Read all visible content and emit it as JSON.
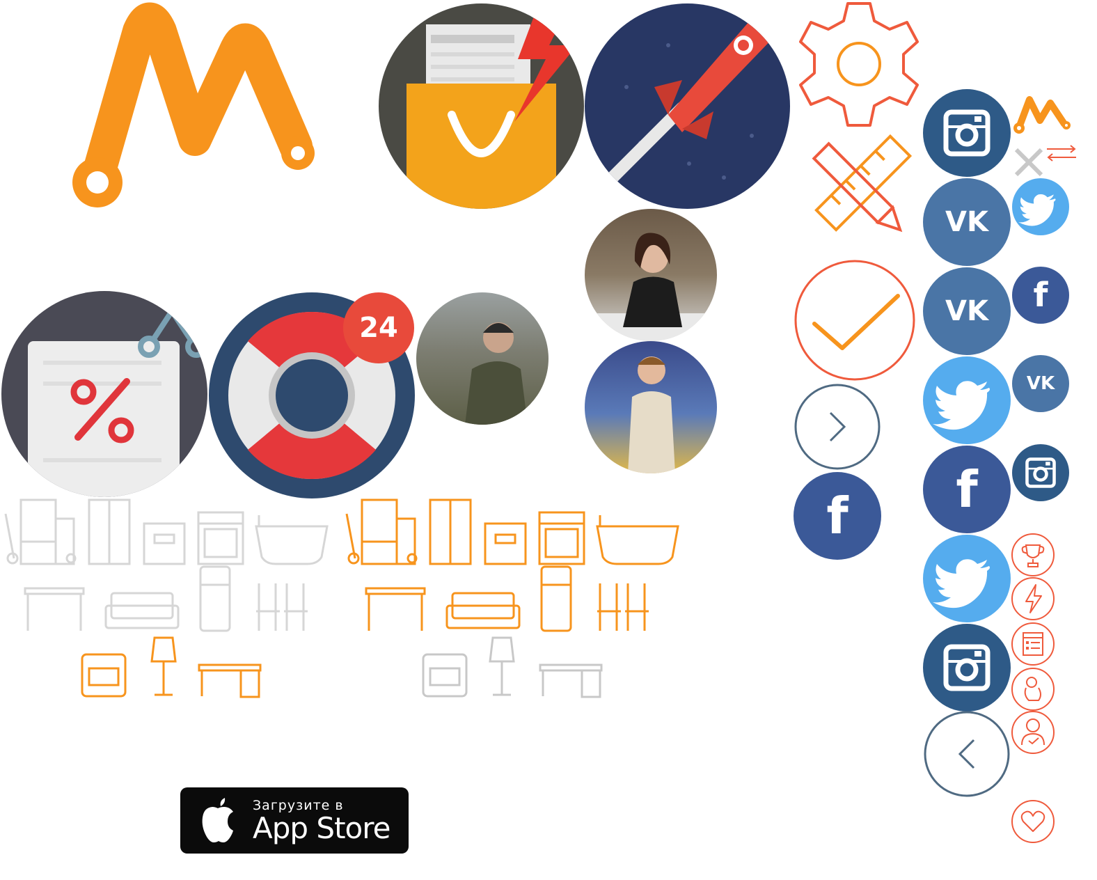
{
  "colors": {
    "brand_orange": "#f7941d",
    "icon_red": "#ef5a3c",
    "instagram": "#2e5a87",
    "vk": "#4a75a6",
    "twitter": "#55acee",
    "facebook": "#3b5998",
    "dark_navy": "#283764",
    "support_navy": "#2e4a6e",
    "gray_line": "#c8c8c8"
  },
  "logo": {
    "icon": "m-logo-icon"
  },
  "icons": {
    "shop": "shopping-bag-icon",
    "rocket": "rocket-icon",
    "gear": "gear-icon",
    "pencil_ruler": "pencil-ruler-icon",
    "check": "check-circle-icon",
    "discount": "discount-coupon-icon",
    "support": "lifebuoy-icon",
    "next": "chevron-right-icon",
    "prev": "chevron-left-icon",
    "close": "close-icon",
    "swap": "swap-arrows-icon",
    "trophy": "trophy-icon",
    "bolt": "lightning-icon",
    "form": "form-icon",
    "hand": "hand-ok-icon",
    "user": "user-check-icon",
    "heart": "heart-icon"
  },
  "support_badge": "24",
  "social": {
    "vk_label": "VK",
    "fb_label": "f"
  },
  "appstore": {
    "small_text": "Загрузите в",
    "big_text": "App Store"
  }
}
